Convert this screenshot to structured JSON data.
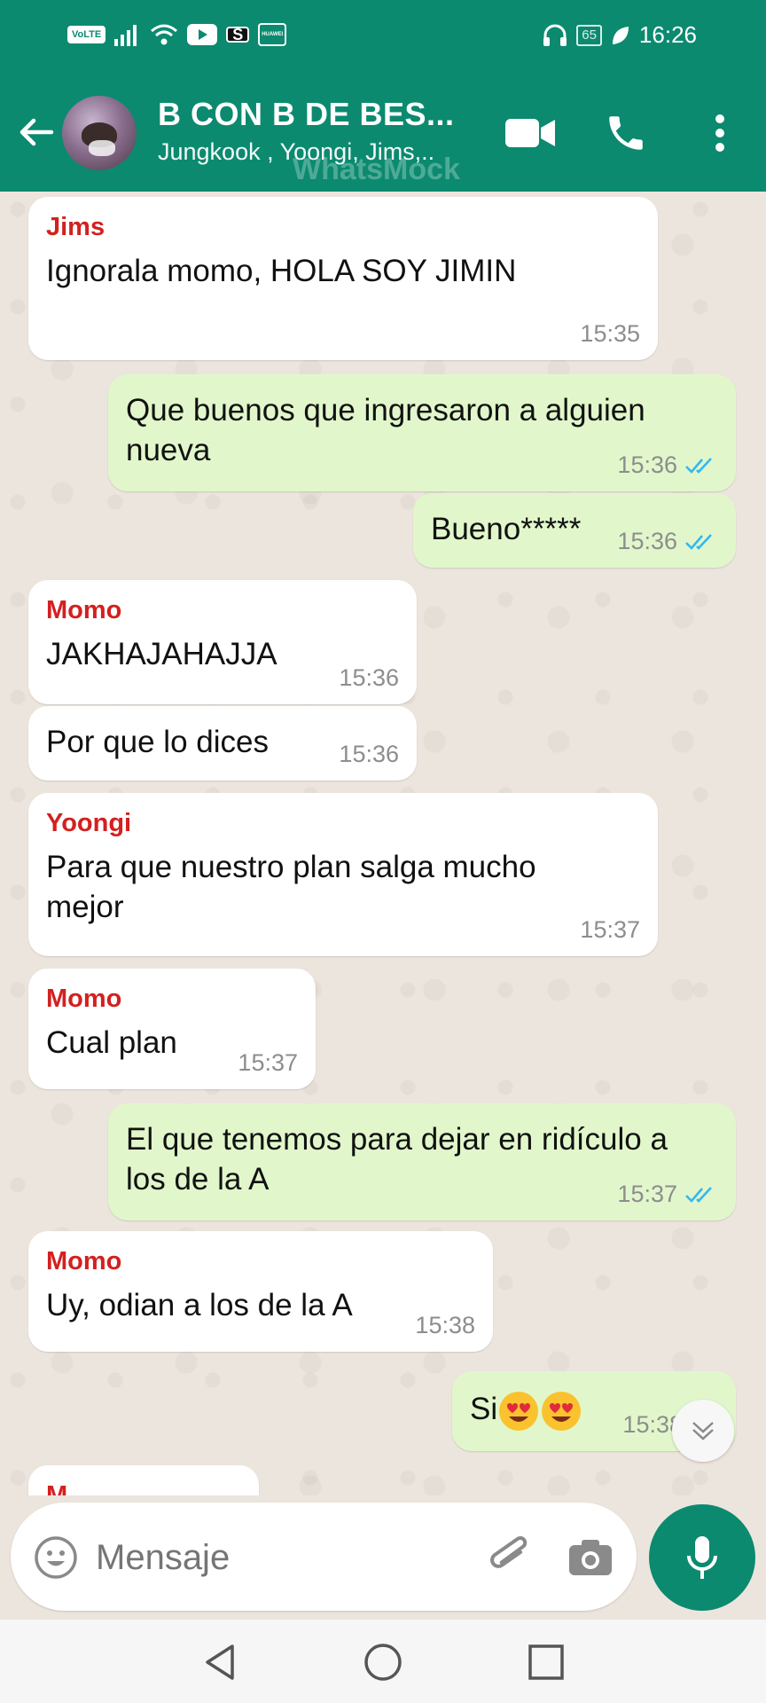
{
  "status_bar": {
    "left_chips": [
      "VoLTE",
      "HUAWEI"
    ],
    "battery": "65",
    "time": "16:26"
  },
  "header": {
    "title": "B CON B DE BES...",
    "subtitle": "Jungkook , Yoongi, Jims,..",
    "watermark": "WhatsMock"
  },
  "messages": [
    {
      "dir": "in",
      "sender": "Jims",
      "text": "Ignorala momo, HOLA SOY JIMIN",
      "time": "15:35"
    },
    {
      "dir": "out",
      "text": "Que buenos que ingresaron a alguien nueva",
      "time": "15:36"
    },
    {
      "dir": "out",
      "text": "Bueno*****",
      "time": "15:36"
    },
    {
      "dir": "in",
      "sender": "Momo",
      "text": "JAKHAJAHAJJA",
      "time": "15:36"
    },
    {
      "dir": "in",
      "text": "Por que lo dices",
      "time": "15:36"
    },
    {
      "dir": "in",
      "sender": "Yoongi",
      "text": "Para que nuestro plan salga mucho mejor",
      "time": "15:37"
    },
    {
      "dir": "in",
      "sender": "Momo",
      "text": "Cual plan",
      "time": "15:37"
    },
    {
      "dir": "out",
      "text": "El que tenemos para dejar en ridículo a los de la A",
      "time": "15:37"
    },
    {
      "dir": "in",
      "sender": "Momo",
      "text": "Uy, odian a los de la A",
      "time": "15:38"
    },
    {
      "dir": "out",
      "text": "Si",
      "time": "15:38"
    },
    {
      "dir": "in",
      "sender": "M",
      "text": "",
      "time": ""
    }
  ],
  "input": {
    "placeholder": "Mensaje"
  },
  "colors": {
    "header": "#0b8a70",
    "outgoing": "#e1f7cb",
    "incoming": "#ffffff",
    "sender": "#d32020",
    "read_ticks": "#34b7f1"
  }
}
